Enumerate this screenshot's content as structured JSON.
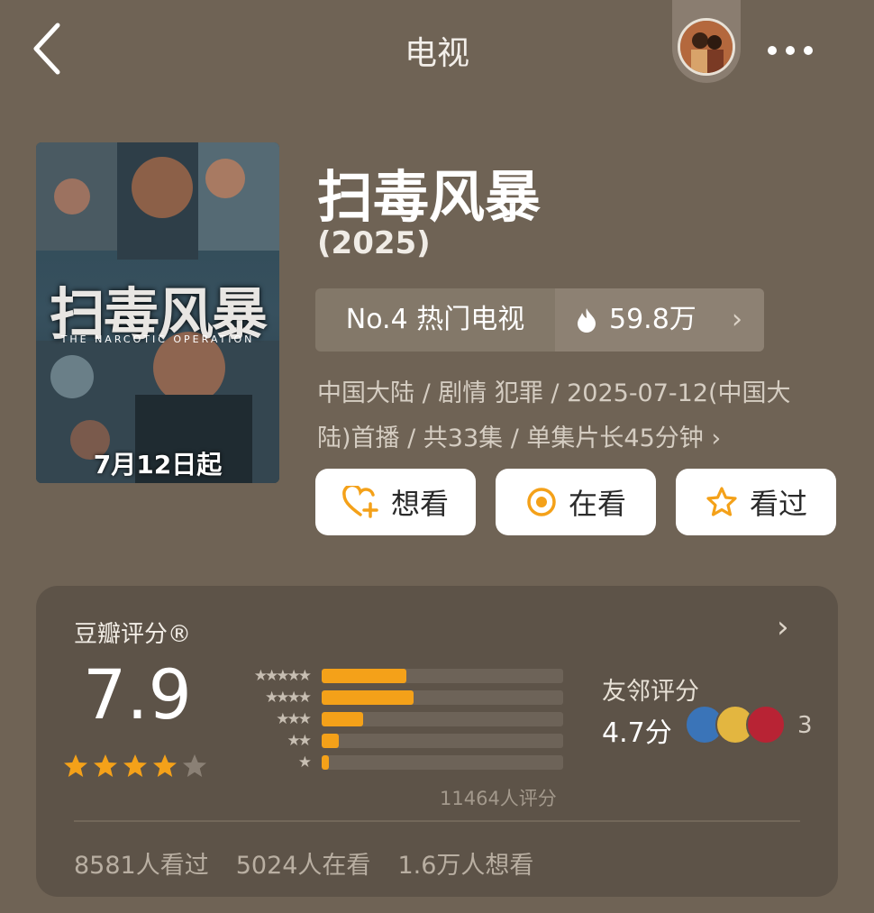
{
  "header": {
    "title": "电视",
    "back_icon": "chevron-left-icon",
    "more_icon": "more-dots-icon"
  },
  "show": {
    "poster_title": "扫毒风暴",
    "poster_subtitle": "THE NARCOTIC OPERATION",
    "poster_date": "7月12日起",
    "title": "扫毒风暴",
    "year": "(2025)",
    "rank": "No.4 热门电视",
    "heat": "59.8万",
    "meta_line1": "中国大陆 / 剧情 犯罪 / 2025-07-12(中国大",
    "meta_line2": "陆)首播 / 共33集 / 单集片长45分钟 ›"
  },
  "actions": [
    {
      "label": "想看",
      "icon": "heart-plus-icon"
    },
    {
      "label": "在看",
      "icon": "target-icon"
    },
    {
      "label": "看过",
      "icon": "star-outline-icon"
    }
  ],
  "rating": {
    "title": "豆瓣评分®",
    "score": "7.9",
    "stars_filled": 4,
    "stars_total": 5,
    "distribution": [
      {
        "stars": "★★★★★",
        "value": 0.35
      },
      {
        "stars": "★★★★",
        "value": 0.38
      },
      {
        "stars": "★★★",
        "value": 0.17
      },
      {
        "stars": "★★",
        "value": 0.07
      },
      {
        "stars": "★",
        "value": 0.03
      }
    ],
    "count_text": "11464人评分",
    "friend_label": "友邻评分",
    "friend_score": "4.7分",
    "friend_count": "3",
    "watched": "8581人看过",
    "watching": "5024人在看",
    "want": "1.6万人想看"
  },
  "colors": {
    "accent": "#f4a119",
    "background": "#6f6355",
    "card": "#5d5348"
  }
}
